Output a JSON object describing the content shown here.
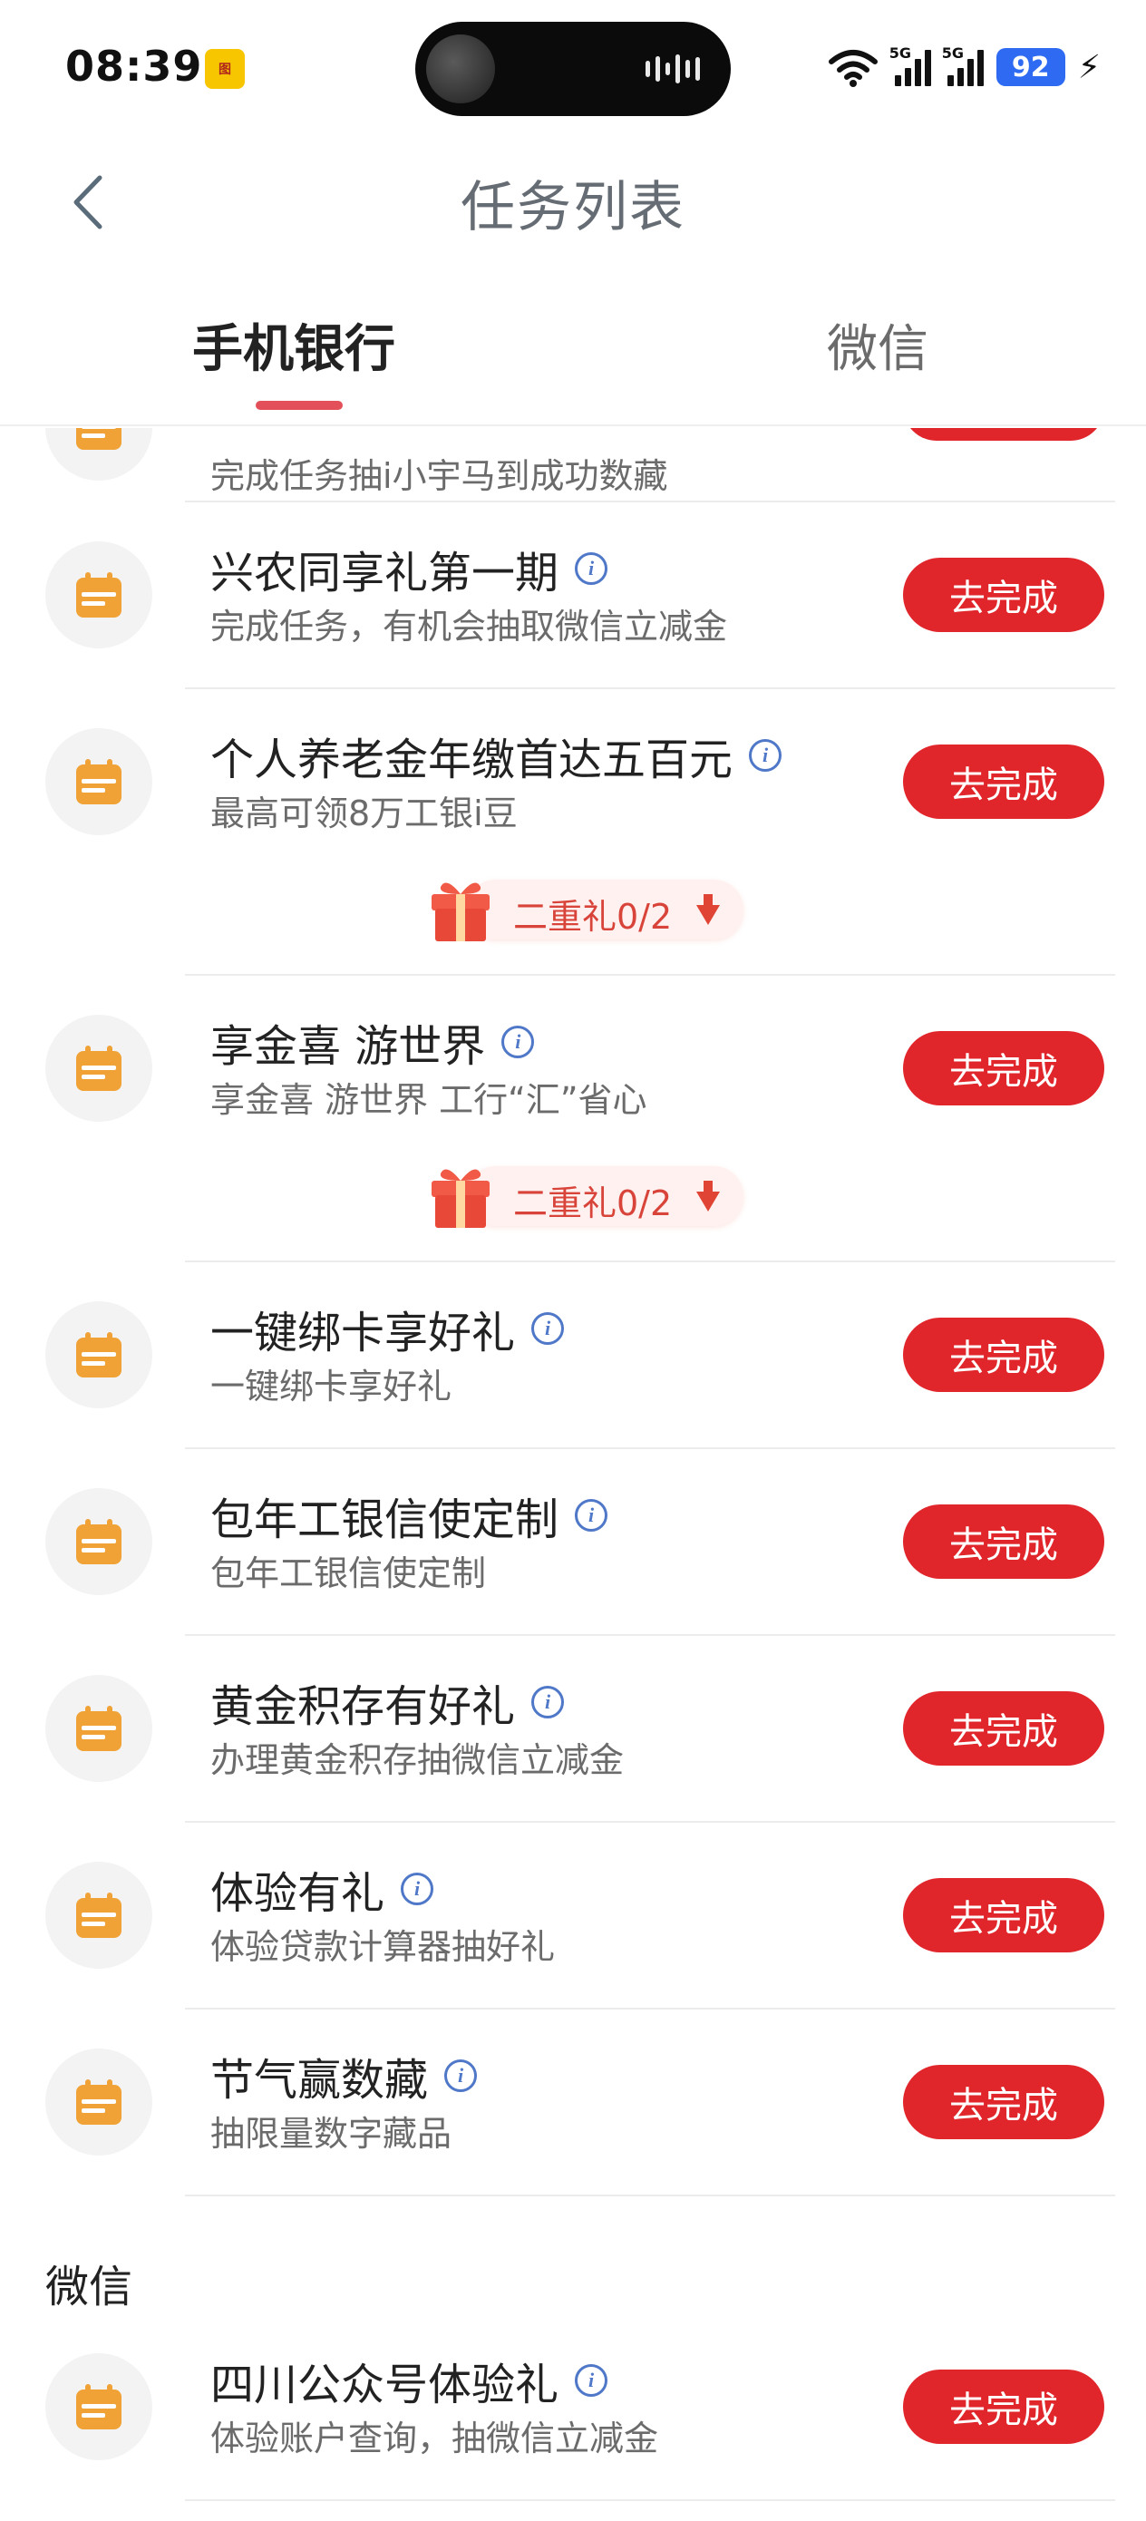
{
  "status": {
    "time": "08:39",
    "battery": "92",
    "network": "5G"
  },
  "header": {
    "title": "任务列表"
  },
  "tabs": [
    {
      "label": "手机银行",
      "active": true
    },
    {
      "label": "微信",
      "active": false
    }
  ],
  "partial_task": {
    "description": "完成任务抽i小宇马到成功数藏"
  },
  "tasks": [
    {
      "title": "兴农同享礼第一期",
      "description": "完成任务，有机会抽取微信立减金",
      "button": "去完成"
    },
    {
      "title": "个人养老金年缴首达五百元",
      "description": "最高可领8万工银i豆",
      "button": "去完成",
      "reward": "二重礼0/2"
    },
    {
      "title": "享金喜 游世界",
      "description": "享金喜 游世界 工行“汇”省心",
      "button": "去完成",
      "reward": "二重礼0/2"
    },
    {
      "title": "一键绑卡享好礼",
      "description": "一键绑卡享好礼",
      "button": "去完成"
    },
    {
      "title": "包年工银信使定制",
      "description": "包年工银信使定制",
      "button": "去完成"
    },
    {
      "title": "黄金积存有好礼",
      "description": "办理黄金积存抽微信立减金",
      "button": "去完成"
    },
    {
      "title": "体验有礼",
      "description": "体验贷款计算器抽好礼",
      "button": "去完成"
    },
    {
      "title": "节气赢数藏",
      "description": "抽限量数字藏品",
      "button": "去完成"
    }
  ],
  "wechat_section": {
    "title": "微信",
    "tasks": [
      {
        "title": "四川公众号体验礼",
        "description": "体验账户查询，抽微信立减金",
        "button": "去完成"
      }
    ]
  },
  "colors": {
    "accent_red": "#e0252b",
    "tab_indicator": "#e4505a",
    "icon_orange": "#f0a236",
    "info_blue": "#4f78c8"
  },
  "icons": {
    "task_icon": "calendar-task-icon",
    "info": "info-icon",
    "gift": "gift-icon",
    "back": "back-arrow-icon"
  }
}
